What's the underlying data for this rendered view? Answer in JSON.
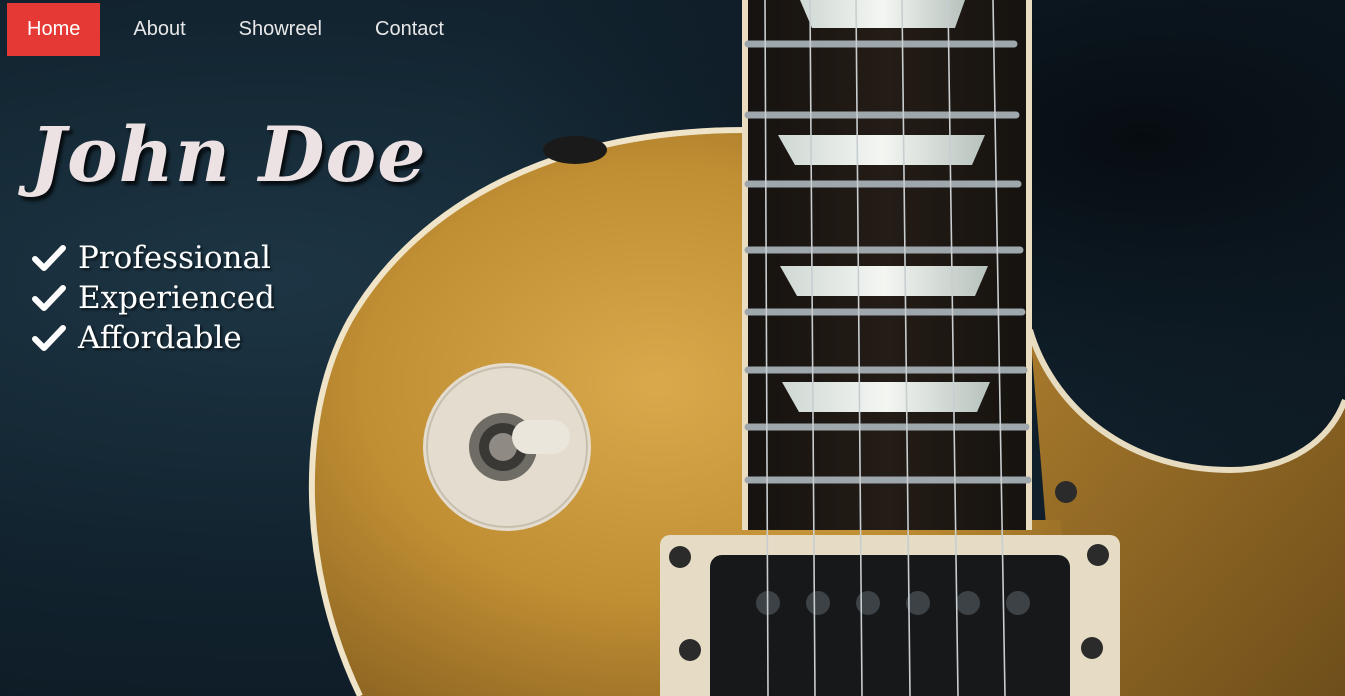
{
  "nav": {
    "items": [
      {
        "label": "Home",
        "active": true
      },
      {
        "label": "About",
        "active": false
      },
      {
        "label": "Showreel",
        "active": false
      },
      {
        "label": "Contact",
        "active": false
      }
    ]
  },
  "hero": {
    "title": "John Doe",
    "features": [
      {
        "label": "Professional",
        "icon": "check-icon"
      },
      {
        "label": "Experienced",
        "icon": "check-icon"
      },
      {
        "label": "Affordable",
        "icon": "check-icon"
      }
    ],
    "background_image": "electric-guitar-photo"
  },
  "colors": {
    "accent": "#e53935",
    "nav_text": "#e8e8e8",
    "title_text": "#ece2e4",
    "background": "#122430",
    "guitar_body": "#c99a3a"
  }
}
